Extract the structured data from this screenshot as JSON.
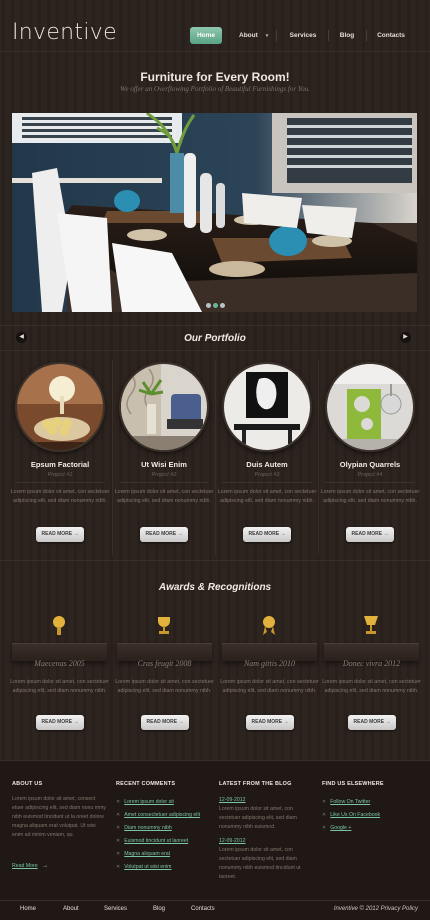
{
  "header": {
    "logo": "Inventive",
    "nav": [
      {
        "label": "Home",
        "active": true
      },
      {
        "label": "About",
        "dropdown": true
      },
      {
        "label": "Services"
      },
      {
        "label": "Blog"
      },
      {
        "label": "Contacts"
      }
    ]
  },
  "hero": {
    "title": "Furniture for Every Room!",
    "subtitle": "We offer an Overflowing Portfolio of Beautiful Furnishings for You.",
    "slides_count": 3,
    "active_slide": 2
  },
  "portfolio": {
    "title": "Our Portfolio",
    "prev_icon": "chevron-left-icon",
    "next_icon": "chevron-right-icon",
    "items": [
      {
        "title": "Epsum Factorial",
        "project": "Project #1",
        "text": "Lorem ipsum dolor sit amet, con sectetuer adipiscing elit, sed diam nonummy nibh.",
        "button": "READ MORE"
      },
      {
        "title": "Ut Wisi Enim",
        "project": "Project #2",
        "text": "Lorem ipsum dolor sit amet, con sectetuer adipiscing elit, sed diam nonummy nibh.",
        "button": "READ MORE"
      },
      {
        "title": "Duis Autem",
        "project": "Project #3",
        "text": "Lorem ipsum dolor sit amet, con sectetuer adipiscing elit, sed diam nonummy nibh.",
        "button": "READ MORE"
      },
      {
        "title": "Olypian Quarrels",
        "project": "Project #4",
        "text": "Lorem ipsum dolor sit amet, con sectetuer adipiscing elit, sed diam nonummy nibh.",
        "button": "READ MORE"
      }
    ]
  },
  "awards": {
    "title": "Awards & Recognitions",
    "items": [
      {
        "title": "Maecenas 2005",
        "text": "Lorem ipsum dolor sit amet, con sectetuer adipiscing elit, sed diam nonummy nibh.",
        "button": "READ MORE",
        "icon": "medal-icon"
      },
      {
        "title": "Cras feugit 2008",
        "text": "Lorem ipsum dolor sit amet, con sectetuer adipiscing elit, sed diam nonummy nibh.",
        "button": "READ MORE",
        "icon": "trophy-icon"
      },
      {
        "title": "Nam gittis 2010",
        "text": "Lorem ipsum dolor sit amet, con sectetuer adipiscing elit, sed diam nonummy nibh.",
        "button": "READ MORE",
        "icon": "rosette-icon"
      },
      {
        "title": "Donec vivra 2012",
        "text": "Lorem ipsum dolor sit amet, con sectetuer adipiscing elit, sed diam nonummy nibh.",
        "button": "READ MORE",
        "icon": "cup-icon"
      }
    ]
  },
  "footer": {
    "about": {
      "heading": "ABOUT US",
      "text": "Lorem ipsum dolor sit amet, consect etuer adipiscing elit, sed diam nonu mmy nibh euismod tincidunt ut la oreet dolore magna aliquam erat volutpat. Ut wisi enim ad minim veniam, qu.",
      "link": "Read More"
    },
    "comments": {
      "heading": "RECENT COMMENTS",
      "items": [
        "Lorem ipsum dolor sit",
        "Amet consectetuer adipiscing elit",
        "Diam nonummy nibh",
        "Euismod tincidunt ut laoreet",
        "Magna aliquam erat",
        "Volutpat ut wisi enim"
      ]
    },
    "blog": {
      "heading": "LATEST FROM THE BLOG",
      "posts": [
        {
          "date": "12-09-2012",
          "text": "Lorem ipsum dolor sit amet, con sectetuer adipiscing elit, sed diam nonummy nibh euismod."
        },
        {
          "date": "12-09-2012",
          "text": "Lorem ipsum dolor sit amet, con sectetuer adipiscing elit, sed diam nonummy nibh euismod tincidunt ut laoreet."
        }
      ]
    },
    "elsewhere": {
      "heading": "FIND US ELSEWHERE",
      "items": [
        "Follow On Twitter",
        "Like Us On Facebook",
        "Google +"
      ]
    }
  },
  "bottom": {
    "nav": [
      "Home",
      "About",
      "Services",
      "Blog",
      "Contacts"
    ],
    "copyright": "Inventive © 2012 Privacy Policy"
  },
  "colors": {
    "accent": "#6ab59a",
    "background": "#2a211c",
    "footer": "#1f1814"
  }
}
